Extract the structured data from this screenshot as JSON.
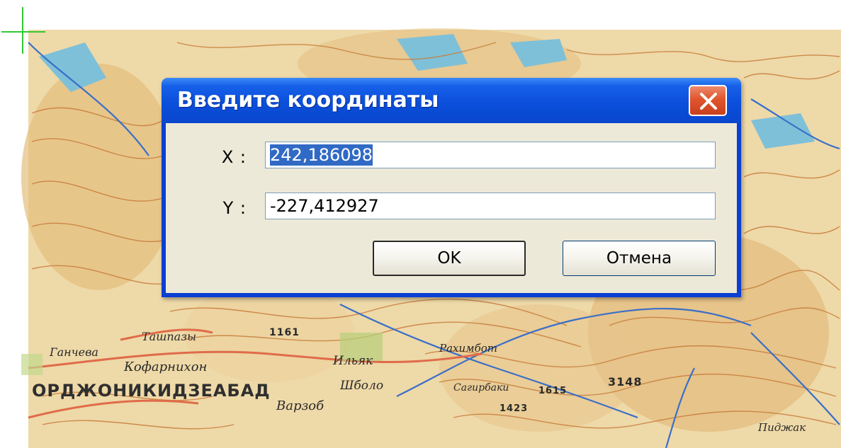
{
  "dialog": {
    "title": "Введите координаты",
    "x_label": "X :",
    "x_value": "242,186098",
    "y_label": "Y :",
    "y_value": "-227,412927",
    "ok_label": "OK",
    "cancel_label": "Отмена"
  },
  "map": {
    "labels": [
      "ОРДЖОНИКИДЗЕАБАД",
      "Кофарнихон",
      "Ганчева",
      "Ильяк",
      "Варзоб",
      "Шболо",
      "Сагирбаки",
      "Ташпазы",
      "1161",
      "3148",
      "1423",
      "1615",
      "Пиджак",
      "Рахимбот"
    ],
    "colors": {
      "paper": "#eed9a8",
      "contour": "#c87c3a",
      "river": "#3a6fc8",
      "lake": "#7ec0d8",
      "road": "#e06b4a"
    }
  },
  "colors": {
    "title_bar": "#0b4fdb",
    "dialog_face": "#ece9d8",
    "selection": "#316ac5",
    "close_button": "#e0552d"
  }
}
